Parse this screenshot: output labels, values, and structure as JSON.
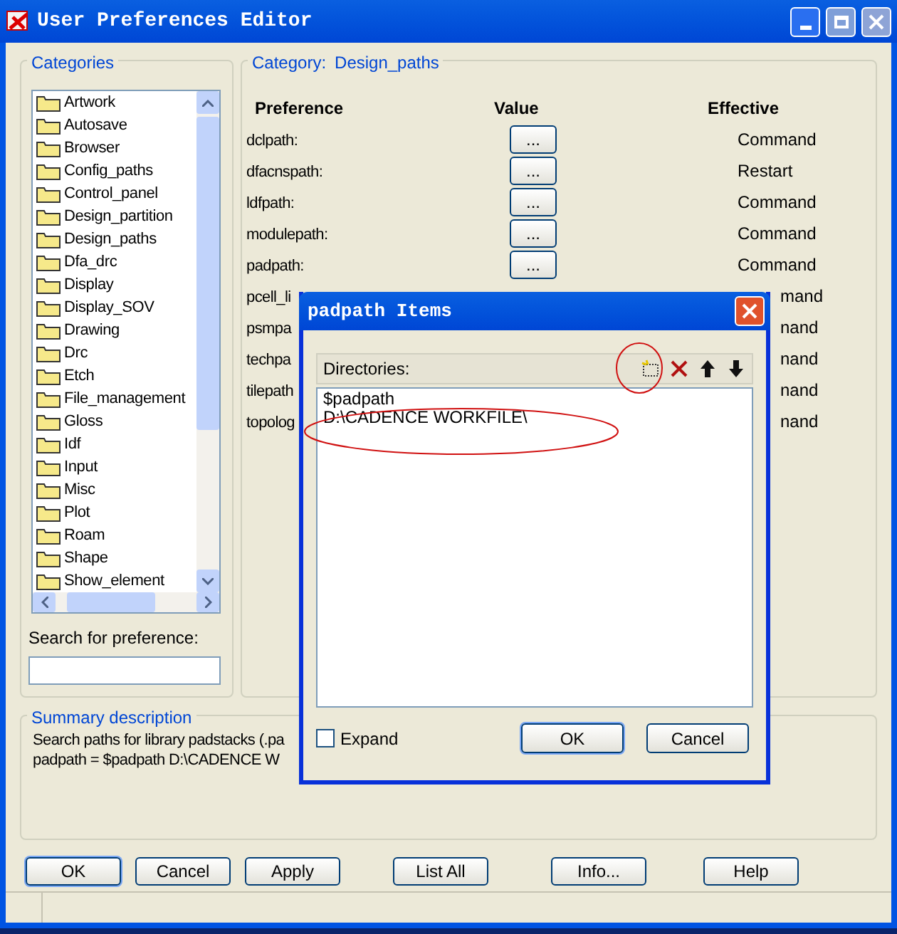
{
  "window": {
    "title": "User Preferences Editor"
  },
  "categories": {
    "title": "Categories",
    "items": [
      "Artwork",
      "Autosave",
      "Browser",
      "Config_paths",
      "Control_panel",
      "Design_partition",
      "Design_paths",
      "Dfa_drc",
      "Display",
      "Display_SOV",
      "Drawing",
      "Drc",
      "Etch",
      "File_management",
      "Gloss",
      "Idf",
      "Input",
      "Misc",
      "Plot",
      "Roam",
      "Shape",
      "Show_element"
    ]
  },
  "search": {
    "label": "Search for preference:"
  },
  "category_panel": {
    "label": "Category:",
    "value": "Design_paths"
  },
  "table": {
    "columns": [
      "Preference",
      "Value",
      "Effective"
    ],
    "rows": [
      {
        "name": "dclpath:",
        "value": "...",
        "effective": "Command"
      },
      {
        "name": "dfacnspath:",
        "value": "...",
        "effective": "Restart"
      },
      {
        "name": "ldfpath:",
        "value": "...",
        "effective": "Command"
      },
      {
        "name": "modulepath:",
        "value": "...",
        "effective": "Command"
      },
      {
        "name": "padpath:",
        "value": "...",
        "effective": "Command"
      },
      {
        "name": "pcell_li",
        "effective": "mand"
      },
      {
        "name": "psmpa",
        "effective": "nand"
      },
      {
        "name": "techpa",
        "effective": "nand"
      },
      {
        "name": "tilepath",
        "effective": "nand"
      },
      {
        "name": "topolog",
        "effective": "nand"
      }
    ]
  },
  "summary": {
    "title": "Summary description",
    "lines": [
      "Search paths for library padstacks (.pa",
      "padpath = $padpath D:\\CADENCE W"
    ]
  },
  "buttons": [
    "OK",
    "Cancel",
    "Apply",
    "List All",
    "Info...",
    "Help"
  ],
  "dialog": {
    "title": "padpath Items",
    "list_label": "Directories:",
    "entries": [
      "$padpath",
      "D:\\CADENCE WORKFILE\\"
    ],
    "expand": {
      "label": "Expand",
      "checked": false
    },
    "buttons": [
      "OK",
      "Cancel"
    ]
  }
}
